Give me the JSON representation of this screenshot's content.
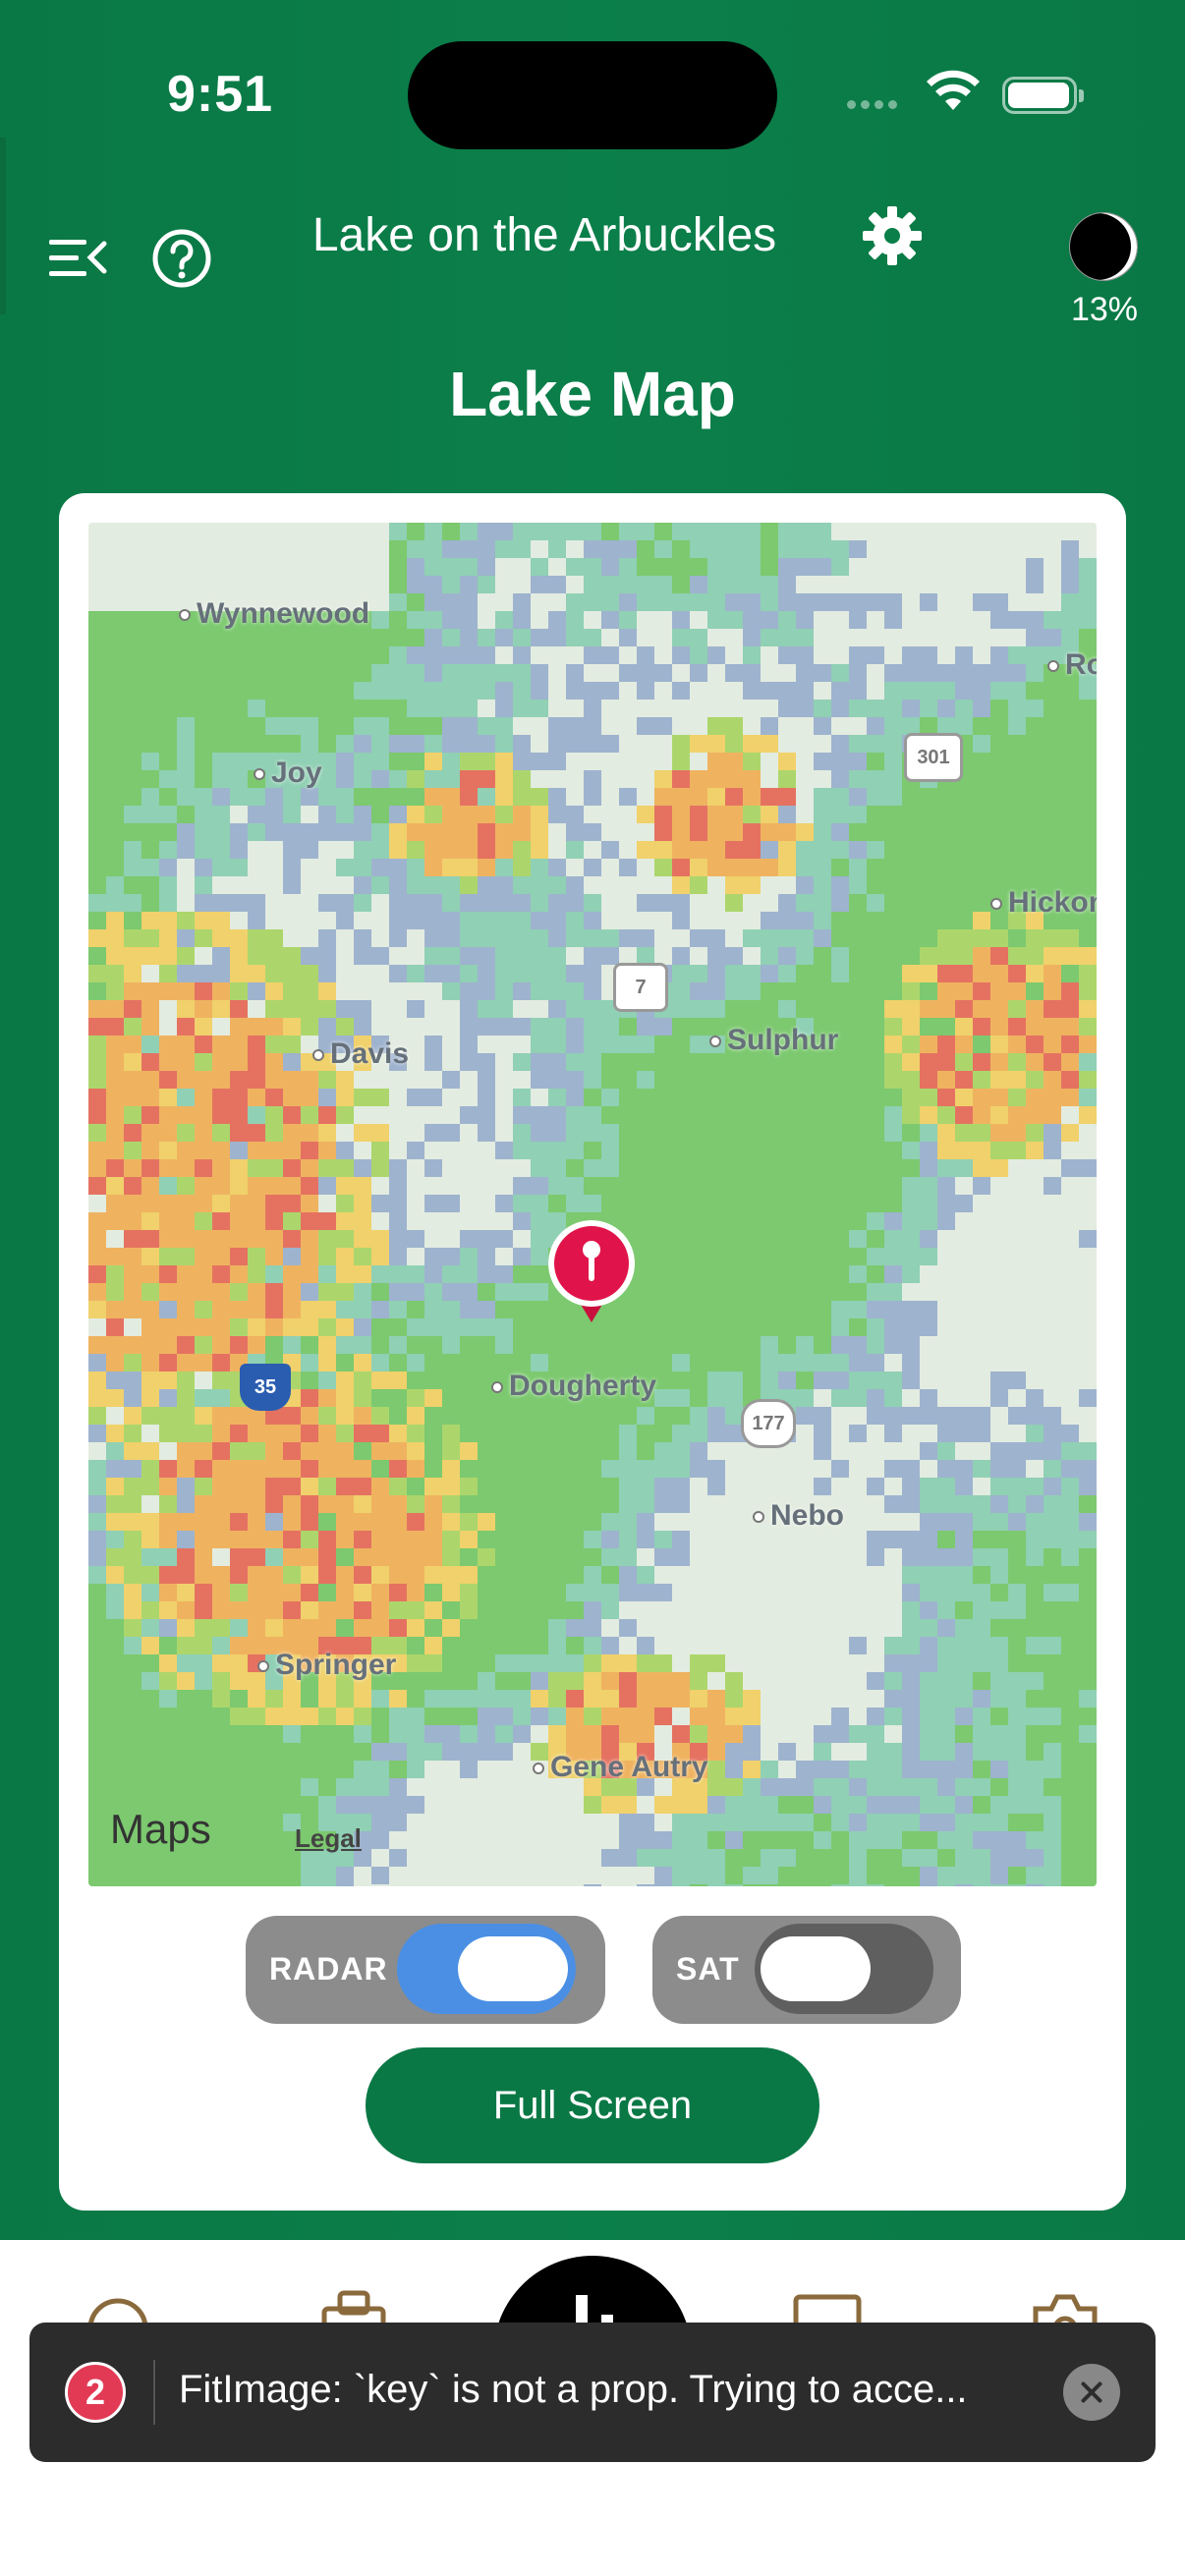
{
  "status_bar": {
    "time": "9:51"
  },
  "header": {
    "lake_name": "Lake on the Arbuckles",
    "moon_percent": "13%",
    "page_title": "Lake Map"
  },
  "map": {
    "towns": [
      "Wynnewood",
      "Joy",
      "Davis",
      "Sulphur",
      "Dougherty",
      "Nebo",
      "Springer",
      "Gene Autry",
      "Hickor",
      "Ro"
    ],
    "route_shields": [
      "301",
      "7",
      "35",
      "177"
    ],
    "attribution": "Maps",
    "legal": "Legal",
    "marker": "map-pin-icon"
  },
  "controls": {
    "radar_label": "RADAR",
    "radar_on": true,
    "sat_label": "SAT",
    "sat_on": false,
    "full_screen": "Full Screen"
  },
  "toast": {
    "count": "2",
    "message": "FitImage: `key` is not a prop. Trying to acce..."
  },
  "colors": {
    "brand_green": "#0a7845",
    "toggle_on": "#4a8fe4",
    "toast_bg": "#2c2c2c",
    "badge_red": "#e23a55"
  }
}
